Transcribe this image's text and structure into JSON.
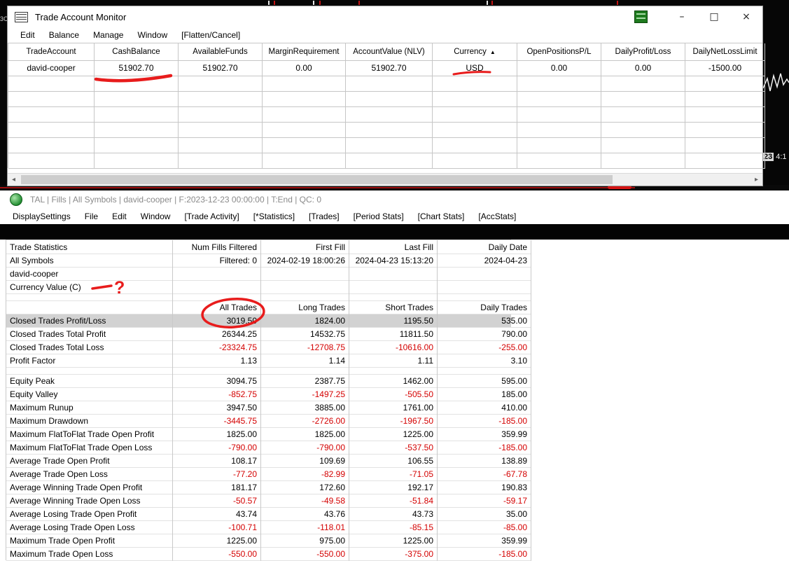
{
  "background": {
    "left_edge_label": "3C",
    "right_axis_day": "23",
    "right_axis_time": "4:1"
  },
  "ui_icons": {
    "minimize": "–",
    "maximize": "□",
    "close": "×",
    "scroll_left": "◂",
    "scroll_right": "▸",
    "sort_ascending": "▲"
  },
  "account_monitor": {
    "title": "Trade Account Monitor",
    "menu": [
      "Edit",
      "Balance",
      "Manage",
      "Window",
      "[Flatten/Cancel]"
    ],
    "columns": [
      "TradeAccount",
      "CashBalance",
      "AvailableFunds",
      "MarginRequirement",
      "AccountValue (NLV)",
      "Currency",
      "OpenPositionsP/L",
      "DailyProfit/Loss",
      "DailyNetLossLimit"
    ],
    "sort_column_index": 5,
    "row": [
      "david-cooper",
      "51902.70",
      "51902.70",
      "0.00",
      "51902.70",
      "USD",
      "0.00",
      "0.00",
      "-1500.00"
    ],
    "empty_rows": 6
  },
  "tal": {
    "title": "TAL | Fills | All Symbols | david-cooper | F:2023-12-23  00:00:00 | T:End | QC: 0",
    "menu": [
      "DisplaySettings",
      "File",
      "Edit",
      "Window",
      "[Trade Activity]",
      "[*Statistics]",
      "[Trades]",
      "[Period Stats]",
      "[Chart Stats]",
      "[AccStats]"
    ],
    "rows": [
      {
        "label": "Trade Statistics",
        "cells": [
          "Num Fills Filtered",
          "First Fill",
          "Last Fill",
          "Daily Date"
        ]
      },
      {
        "label": "All Symbols",
        "cells": [
          "Filtered: 0",
          "2024-02-19 18:00:26",
          "2024-04-23 15:13:20",
          "2024-04-23"
        ]
      },
      {
        "label": "david-cooper",
        "cells": [
          "",
          "",
          "",
          ""
        ]
      },
      {
        "label": "Currency Value (C)",
        "cells": [
          "",
          "",
          "",
          ""
        ]
      },
      {
        "label": "",
        "cells": [
          "",
          "",
          "",
          ""
        ],
        "spacer": true
      },
      {
        "label": "",
        "cells": [
          "All Trades",
          "Long Trades",
          "Short Trades",
          "Daily Trades"
        ]
      },
      {
        "label": "Closed Trades Profit/Loss",
        "cells": [
          "3019.50",
          "1824.00",
          "1195.50",
          "535.00"
        ],
        "highlight": true
      },
      {
        "label": "Closed Trades Total Profit",
        "cells": [
          "26344.25",
          "14532.75",
          "11811.50",
          "790.00"
        ]
      },
      {
        "label": "Closed Trades Total Loss",
        "cells": [
          "-23324.75",
          "-12708.75",
          "-10616.00",
          "-255.00"
        ]
      },
      {
        "label": "Profit Factor",
        "cells": [
          "1.13",
          "1.14",
          "1.11",
          "3.10"
        ]
      },
      {
        "label": "",
        "cells": [
          "",
          "",
          "",
          ""
        ],
        "spacer": true
      },
      {
        "label": "Equity Peak",
        "cells": [
          "3094.75",
          "2387.75",
          "1462.00",
          "595.00"
        ]
      },
      {
        "label": "Equity Valley",
        "cells": [
          "-852.75",
          "-1497.25",
          "-505.50",
          "185.00"
        ]
      },
      {
        "label": "Maximum Runup",
        "cells": [
          "3947.50",
          "3885.00",
          "1761.00",
          "410.00"
        ]
      },
      {
        "label": "Maximum Drawdown",
        "cells": [
          "-3445.75",
          "-2726.00",
          "-1967.50",
          "-185.00"
        ]
      },
      {
        "label": "Maximum FlatToFlat Trade Open Profit",
        "cells": [
          "1825.00",
          "1825.00",
          "1225.00",
          "359.99"
        ]
      },
      {
        "label": "Maximum FlatToFlat Trade Open Loss",
        "cells": [
          "-790.00",
          "-790.00",
          "-537.50",
          "-185.00"
        ]
      },
      {
        "label": "Average Trade Open Profit",
        "cells": [
          "108.17",
          "109.69",
          "106.55",
          "138.89"
        ]
      },
      {
        "label": "Average Trade Open Loss",
        "cells": [
          "-77.20",
          "-82.99",
          "-71.05",
          "-67.78"
        ]
      },
      {
        "label": "Average Winning Trade Open Profit",
        "cells": [
          "181.17",
          "172.60",
          "192.17",
          "190.83"
        ]
      },
      {
        "label": "Average Winning Trade Open Loss",
        "cells": [
          "-50.57",
          "-49.58",
          "-51.84",
          "-59.17"
        ]
      },
      {
        "label": "Average Losing Trade Open Profit",
        "cells": [
          "43.74",
          "43.76",
          "43.73",
          "35.00"
        ]
      },
      {
        "label": "Average Losing Trade Open Loss",
        "cells": [
          "-100.71",
          "-118.01",
          "-85.15",
          "-85.00"
        ]
      },
      {
        "label": "Maximum Trade Open Profit",
        "cells": [
          "1225.00",
          "975.00",
          "1225.00",
          "359.99"
        ]
      },
      {
        "label": "Maximum Trade Open Loss",
        "cells": [
          "-550.00",
          "-550.00",
          "-375.00",
          "-185.00"
        ]
      }
    ]
  },
  "annotations": {
    "question_mark": "?"
  }
}
